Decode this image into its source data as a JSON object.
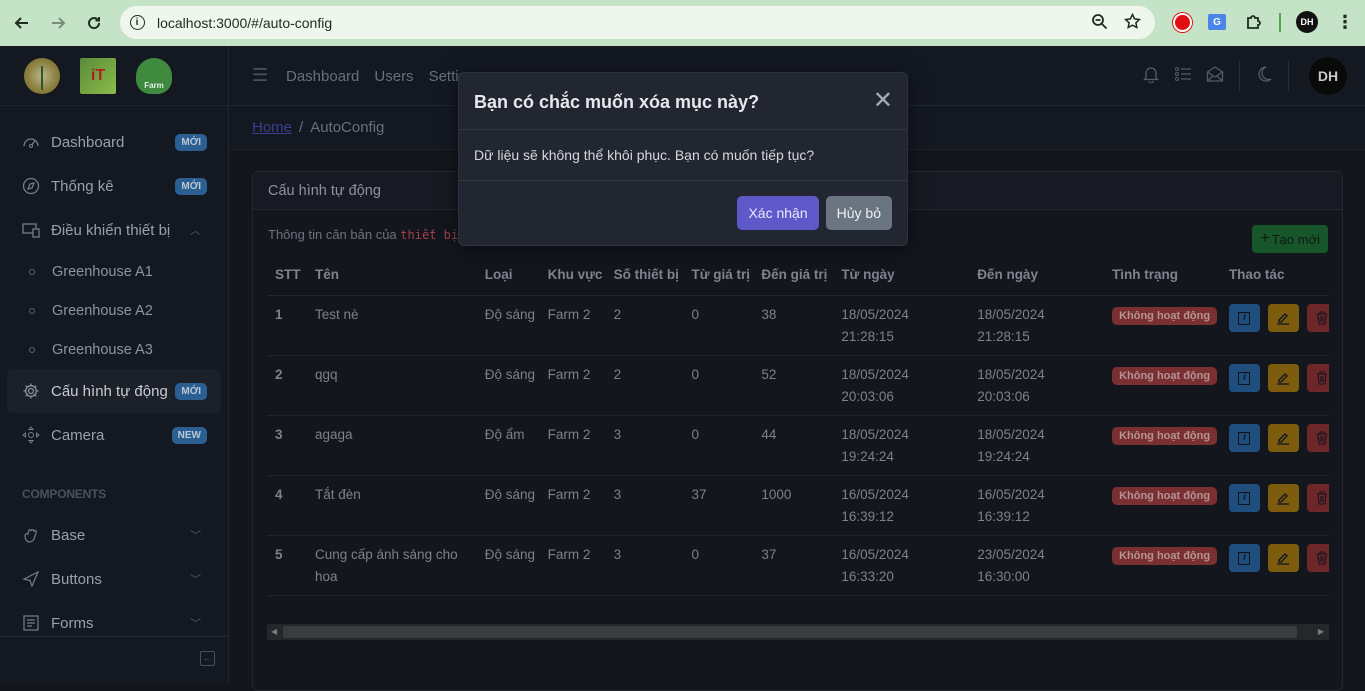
{
  "browser": {
    "url": "localhost:3000/#/auto-config",
    "profile_initials": "DH"
  },
  "sidebar": {
    "items": [
      {
        "label": "Dashboard",
        "badge": "MỚI",
        "icon": "speedometer-icon"
      },
      {
        "label": "Thống kê",
        "badge": "MỚI",
        "icon": "compass-icon"
      },
      {
        "label": "Điều khiển thiết bị",
        "icon": "devices-icon",
        "expanded": true,
        "children": [
          {
            "label": "Greenhouse A1"
          },
          {
            "label": "Greenhouse A2"
          },
          {
            "label": "Greenhouse A3"
          }
        ]
      },
      {
        "label": "Cấu hình tự động",
        "badge": "MỚI",
        "icon": "gear-icon",
        "active": true
      },
      {
        "label": "Camera",
        "badge": "NEW",
        "icon": "move-icon"
      }
    ],
    "section_title": "COMPONENTS",
    "components": [
      {
        "label": "Base",
        "icon": "puzzle-icon"
      },
      {
        "label": "Buttons",
        "icon": "cursor-icon"
      },
      {
        "label": "Forms",
        "icon": "notes-icon"
      }
    ]
  },
  "header": {
    "nav": [
      "Dashboard",
      "Users",
      "Settings"
    ],
    "avatar_initials": "DH"
  },
  "breadcrumb": {
    "home": "Home",
    "current": "AutoConfig"
  },
  "card": {
    "title": "Cấu hình tự động",
    "subtitle_prefix": "Thông tin căn bản của",
    "subtitle_code": "thiết bị",
    "create_label": "Tạo mới"
  },
  "table": {
    "headers": [
      "STT",
      "Tên",
      "Loại",
      "Khu vực",
      "Số thiết bị",
      "Từ giá trị",
      "Đến giá trị",
      "Từ ngày",
      "Đến ngày",
      "Tình trạng",
      "Thao tác"
    ],
    "rows": [
      {
        "stt": "1",
        "name": "Test nè",
        "type": "Độ sáng",
        "area": "Farm 2",
        "devices": "2",
        "from_value": "0",
        "to_value": "38",
        "from_date": "18/05/2024",
        "from_time": "21:28:15",
        "to_date": "18/05/2024",
        "to_time": "21:28:15",
        "status": "Không hoạt động"
      },
      {
        "stt": "2",
        "name": "qgq",
        "type": "Độ sáng",
        "area": "Farm 2",
        "devices": "2",
        "from_value": "0",
        "to_value": "52",
        "from_date": "18/05/2024",
        "from_time": "20:03:06",
        "to_date": "18/05/2024",
        "to_time": "20:03:06",
        "status": "Không hoạt động"
      },
      {
        "stt": "3",
        "name": "agaga",
        "type": "Độ ẩm",
        "area": "Farm 2",
        "devices": "3",
        "from_value": "0",
        "to_value": "44",
        "from_date": "18/05/2024",
        "from_time": "19:24:24",
        "to_date": "18/05/2024",
        "to_time": "19:24:24",
        "status": "Không hoạt động"
      },
      {
        "stt": "4",
        "name": "Tắt đèn",
        "type": "Độ sáng",
        "area": "Farm 2",
        "devices": "3",
        "from_value": "37",
        "to_value": "1000",
        "from_date": "16/05/2024",
        "from_time": "16:39:12",
        "to_date": "16/05/2024",
        "to_time": "16:39:12",
        "status": "Không hoạt động"
      },
      {
        "stt": "5",
        "name": "Cung cấp ánh sáng cho hoa",
        "type": "Độ sáng",
        "area": "Farm 2",
        "devices": "3",
        "from_value": "0",
        "to_value": "37",
        "from_date": "16/05/2024",
        "from_time": "16:33:20",
        "to_date": "23/05/2024",
        "to_time": "16:30:00",
        "status": "Không hoạt động"
      }
    ]
  },
  "modal": {
    "title": "Bạn có chắc muốn xóa mục này?",
    "body": "Dữ liệu sẽ không thể khôi phục. Bạn có muốn tiếp tục?",
    "confirm_label": "Xác nhận",
    "cancel_label": "Hủy bỏ"
  },
  "colors": {
    "primary": "#5f58c9",
    "secondary": "#6b7582",
    "success": "#17562a",
    "danger": "#7a2f31",
    "info": "#1f4d7c",
    "warning": "#7d5c0d"
  }
}
